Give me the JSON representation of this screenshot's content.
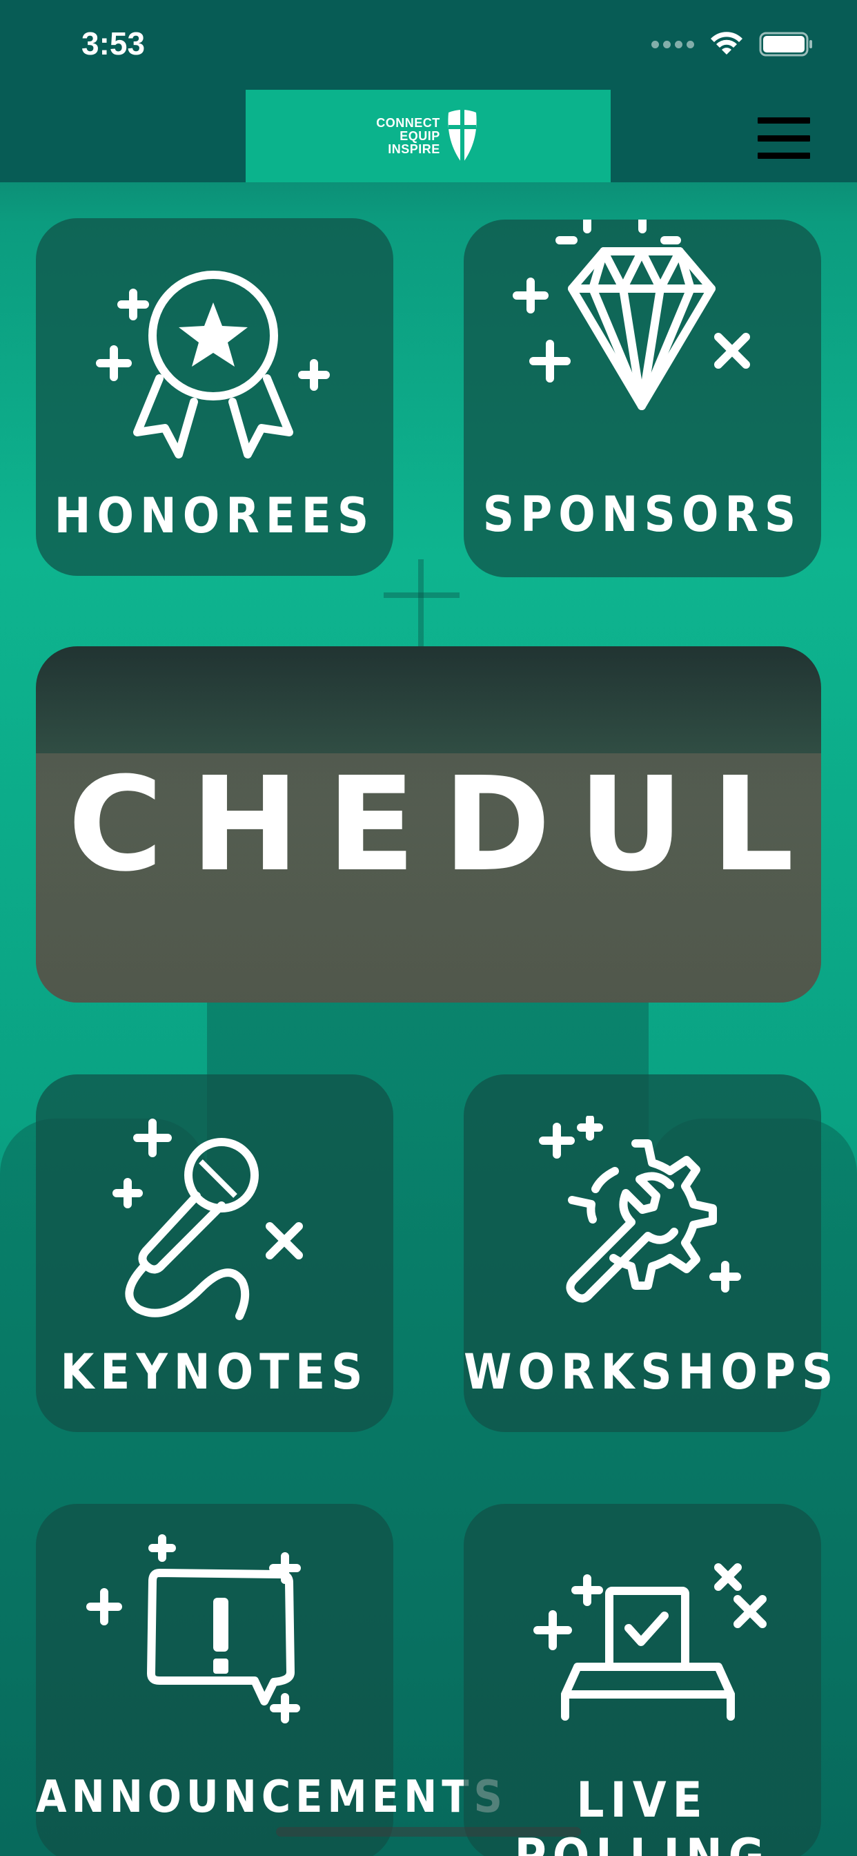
{
  "status_bar": {
    "time": "3:53"
  },
  "header": {
    "logo_lines": [
      "CONNECT",
      "EQUIP",
      "INSPIRE"
    ]
  },
  "tiles": {
    "honorees": "HONOREES",
    "sponsors": "SPONSORS",
    "schedule": "SCHEDULE",
    "keynotes": "KEYNOTES",
    "workshops": "WORKSHOPS",
    "announcements": "ANNOUNCEMENTS",
    "live_polling": "LIVE POLLING"
  },
  "icons": {
    "honorees": "award-ribbon-icon",
    "sponsors": "diamond-icon",
    "keynotes": "microphone-icon",
    "workshops": "gear-wrench-icon",
    "announcements": "alert-speech-bubble-icon",
    "live_polling": "ballot-box-icon"
  },
  "colors": {
    "header_bg": "#075c55",
    "logo_bg": "#0bb38c",
    "tile_bg": "#105046"
  }
}
